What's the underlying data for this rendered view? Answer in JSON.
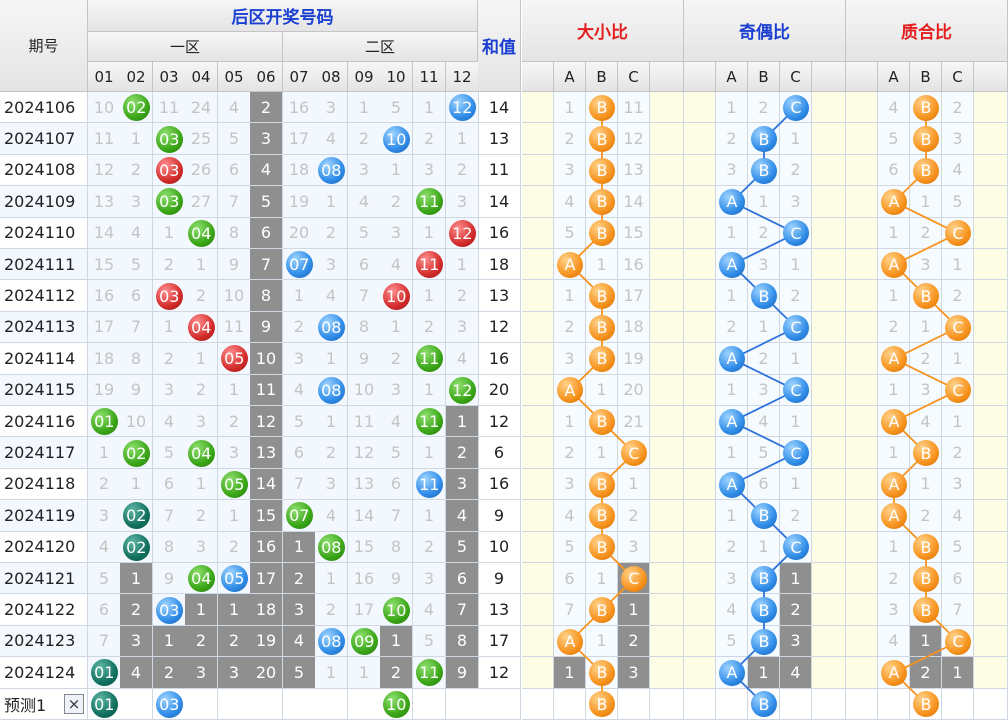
{
  "header": {
    "period": "期号",
    "back_zone": "后区开奖号码",
    "zone1": "一区",
    "zone2": "二区",
    "sum": "和值",
    "ratio_size": "大小比",
    "ratio_parity": "奇偶比",
    "ratio_prime": "质合比",
    "col_nums": [
      "01",
      "02",
      "03",
      "04",
      "05",
      "06",
      "07",
      "08",
      "09",
      "10",
      "11",
      "12"
    ],
    "abc": [
      "A",
      "B",
      "C"
    ]
  },
  "colors": {
    "green": "#3aa617",
    "red": "#d42c2c",
    "blue": "#2f8ce8",
    "teal": "#11705f",
    "orange": "#f7931e",
    "omit_gray": "#8f8f8f"
  },
  "rows": [
    {
      "period": "2024106",
      "cells": [
        "10",
        "02",
        "11",
        "24",
        "4",
        "2",
        "16",
        "3",
        "1",
        "5",
        "1",
        "12"
      ],
      "balls": {
        "1": "green",
        "11": "blue"
      },
      "gray": [
        5
      ],
      "sum": "14",
      "size": [
        "1",
        "B",
        "11"
      ],
      "size_pick": 1,
      "parity": [
        "1",
        "2",
        "C"
      ],
      "parity_pick": 2,
      "prime": [
        "4",
        "B",
        "2"
      ],
      "prime_pick": 1
    },
    {
      "period": "2024107",
      "cells": [
        "11",
        "1",
        "03",
        "25",
        "5",
        "3",
        "17",
        "4",
        "2",
        "10",
        "2",
        "1"
      ],
      "balls": {
        "2": "green",
        "9": "blue"
      },
      "gray": [
        5
      ],
      "sum": "13",
      "size": [
        "2",
        "B",
        "12"
      ],
      "size_pick": 1,
      "parity": [
        "2",
        "B",
        "1"
      ],
      "parity_pick": 1,
      "prime": [
        "5",
        "B",
        "3"
      ],
      "prime_pick": 1
    },
    {
      "period": "2024108",
      "cells": [
        "12",
        "2",
        "03",
        "26",
        "6",
        "4",
        "18",
        "08",
        "3",
        "1",
        "3",
        "2"
      ],
      "balls": {
        "2": "red",
        "7": "blue"
      },
      "gray": [
        5
      ],
      "sum": "11",
      "size": [
        "3",
        "B",
        "13"
      ],
      "size_pick": 1,
      "parity": [
        "3",
        "B",
        "2"
      ],
      "parity_pick": 1,
      "prime": [
        "6",
        "B",
        "4"
      ],
      "prime_pick": 1
    },
    {
      "period": "2024109",
      "cells": [
        "13",
        "3",
        "03",
        "27",
        "7",
        "5",
        "19",
        "1",
        "4",
        "2",
        "11",
        "3"
      ],
      "balls": {
        "2": "green",
        "10": "green"
      },
      "gray": [
        5
      ],
      "sum": "14",
      "size": [
        "4",
        "B",
        "14"
      ],
      "size_pick": 1,
      "parity": [
        "A",
        "1",
        "3"
      ],
      "parity_pick": 0,
      "prime": [
        "A",
        "1",
        "5"
      ],
      "prime_pick": 0
    },
    {
      "period": "2024110",
      "cells": [
        "14",
        "4",
        "1",
        "04",
        "8",
        "6",
        "20",
        "2",
        "5",
        "3",
        "1",
        "12"
      ],
      "balls": {
        "3": "green",
        "11": "red"
      },
      "gray": [
        5
      ],
      "sum": "16",
      "size": [
        "5",
        "B",
        "15"
      ],
      "size_pick": 1,
      "parity": [
        "1",
        "2",
        "C"
      ],
      "parity_pick": 2,
      "prime": [
        "1",
        "2",
        "C"
      ],
      "prime_pick": 2
    },
    {
      "period": "2024111",
      "cells": [
        "15",
        "5",
        "2",
        "1",
        "9",
        "7",
        "07",
        "3",
        "6",
        "4",
        "11",
        "1"
      ],
      "balls": {
        "6": "blue",
        "10": "red"
      },
      "gray": [
        5
      ],
      "sum": "18",
      "size": [
        "A",
        "1",
        "16"
      ],
      "size_pick": 0,
      "parity": [
        "A",
        "3",
        "1"
      ],
      "parity_pick": 0,
      "prime": [
        "A",
        "3",
        "1"
      ],
      "prime_pick": 0
    },
    {
      "period": "2024112",
      "cells": [
        "16",
        "6",
        "03",
        "2",
        "10",
        "8",
        "1",
        "4",
        "7",
        "10",
        "1",
        "2"
      ],
      "balls": {
        "2": "red",
        "9": "red"
      },
      "gray": [
        5
      ],
      "sum": "13",
      "size": [
        "1",
        "B",
        "17"
      ],
      "size_pick": 1,
      "parity": [
        "1",
        "B",
        "2"
      ],
      "parity_pick": 1,
      "prime": [
        "1",
        "B",
        "2"
      ],
      "prime_pick": 1
    },
    {
      "period": "2024113",
      "cells": [
        "17",
        "7",
        "1",
        "04",
        "11",
        "9",
        "2",
        "08",
        "8",
        "1",
        "2",
        "3"
      ],
      "balls": {
        "3": "red",
        "7": "blue"
      },
      "gray": [
        5
      ],
      "sum": "12",
      "size": [
        "2",
        "B",
        "18"
      ],
      "size_pick": 1,
      "parity": [
        "2",
        "1",
        "C"
      ],
      "parity_pick": 2,
      "prime": [
        "2",
        "1",
        "C"
      ],
      "prime_pick": 2
    },
    {
      "period": "2024114",
      "cells": [
        "18",
        "8",
        "2",
        "1",
        "05",
        "10",
        "3",
        "1",
        "9",
        "2",
        "11",
        "4"
      ],
      "balls": {
        "4": "red",
        "10": "green"
      },
      "gray": [
        5
      ],
      "sum": "16",
      "size": [
        "3",
        "B",
        "19"
      ],
      "size_pick": 1,
      "parity": [
        "A",
        "2",
        "1"
      ],
      "parity_pick": 0,
      "prime": [
        "A",
        "2",
        "1"
      ],
      "prime_pick": 0
    },
    {
      "period": "2024115",
      "cells": [
        "19",
        "9",
        "3",
        "2",
        "1",
        "11",
        "4",
        "08",
        "10",
        "3",
        "1",
        "12"
      ],
      "balls": {
        "7": "blue",
        "11": "green"
      },
      "gray": [
        5
      ],
      "sum": "20",
      "size": [
        "A",
        "1",
        "20"
      ],
      "size_pick": 0,
      "parity": [
        "1",
        "3",
        "C"
      ],
      "parity_pick": 2,
      "prime": [
        "1",
        "3",
        "C"
      ],
      "prime_pick": 2
    },
    {
      "period": "2024116",
      "cells": [
        "01",
        "10",
        "4",
        "3",
        "2",
        "12",
        "5",
        "1",
        "11",
        "4",
        "11",
        "1"
      ],
      "balls": {
        "0": "green",
        "10": "green"
      },
      "gray": [
        5,
        11
      ],
      "sum": "12",
      "size": [
        "1",
        "B",
        "21"
      ],
      "size_pick": 1,
      "parity": [
        "A",
        "4",
        "1"
      ],
      "parity_pick": 0,
      "prime": [
        "A",
        "4",
        "1"
      ],
      "prime_pick": 0
    },
    {
      "period": "2024117",
      "cells": [
        "1",
        "02",
        "5",
        "04",
        "3",
        "13",
        "6",
        "2",
        "12",
        "5",
        "1",
        "2"
      ],
      "balls": {
        "1": "green",
        "3": "green"
      },
      "gray": [
        5,
        11
      ],
      "sum": "6",
      "size": [
        "2",
        "1",
        "C"
      ],
      "size_pick": 2,
      "parity": [
        "1",
        "5",
        "C"
      ],
      "parity_pick": 2,
      "prime": [
        "1",
        "B",
        "2"
      ],
      "prime_pick": 1
    },
    {
      "period": "2024118",
      "cells": [
        "2",
        "1",
        "6",
        "1",
        "05",
        "14",
        "7",
        "3",
        "13",
        "6",
        "11",
        "3"
      ],
      "balls": {
        "4": "green",
        "10": "blue"
      },
      "gray": [
        5,
        11
      ],
      "sum": "16",
      "size": [
        "3",
        "B",
        "1"
      ],
      "size_pick": 1,
      "parity": [
        "A",
        "6",
        "1"
      ],
      "parity_pick": 0,
      "prime": [
        "A",
        "1",
        "3"
      ],
      "prime_pick": 0
    },
    {
      "period": "2024119",
      "cells": [
        "3",
        "02",
        "7",
        "2",
        "1",
        "15",
        "07",
        "4",
        "14",
        "7",
        "1",
        "4"
      ],
      "balls": {
        "1": "teal",
        "6": "green"
      },
      "gray": [
        5,
        11
      ],
      "sum": "9",
      "size": [
        "4",
        "B",
        "2"
      ],
      "size_pick": 1,
      "parity": [
        "1",
        "B",
        "2"
      ],
      "parity_pick": 1,
      "prime": [
        "A",
        "2",
        "4"
      ],
      "prime_pick": 0
    },
    {
      "period": "2024120",
      "cells": [
        "4",
        "02",
        "8",
        "3",
        "2",
        "16",
        "1",
        "08",
        "15",
        "8",
        "2",
        "5"
      ],
      "balls": {
        "1": "teal",
        "7": "green"
      },
      "gray": [
        5,
        6,
        11
      ],
      "sum": "10",
      "size": [
        "5",
        "B",
        "3"
      ],
      "size_pick": 1,
      "parity": [
        "2",
        "1",
        "C"
      ],
      "parity_pick": 2,
      "prime": [
        "1",
        "B",
        "5"
      ],
      "prime_pick": 1
    },
    {
      "period": "2024121",
      "cells": [
        "5",
        "1",
        "9",
        "04",
        "05",
        "17",
        "2",
        "1",
        "16",
        "9",
        "3",
        "6"
      ],
      "balls": {
        "3": "green",
        "4": "blue"
      },
      "gray": [
        1,
        5,
        6,
        11
      ],
      "sum": "9",
      "size": [
        "6",
        "1",
        "C"
      ],
      "size_pick": 2,
      "parity": [
        "3",
        "B",
        "1"
      ],
      "parity_pick": 1,
      "prime": [
        "2",
        "B",
        "6"
      ],
      "prime_pick": 1
    },
    {
      "period": "2024122",
      "cells": [
        "6",
        "2",
        "03",
        "1",
        "1",
        "18",
        "3",
        "2",
        "17",
        "10",
        "4",
        "7"
      ],
      "balls": {
        "2": "blue",
        "9": "green"
      },
      "gray": [
        1,
        3,
        4,
        5,
        6,
        11
      ],
      "sum": "13",
      "size": [
        "7",
        "B",
        "1"
      ],
      "size_pick": 1,
      "parity": [
        "4",
        "B",
        "2"
      ],
      "parity_pick": 1,
      "prime": [
        "3",
        "B",
        "7"
      ],
      "prime_pick": 1
    },
    {
      "period": "2024123",
      "cells": [
        "7",
        "3",
        "1",
        "2",
        "2",
        "19",
        "4",
        "08",
        "09",
        "1",
        "5",
        "8"
      ],
      "balls": {
        "7": "blue",
        "8": "green"
      },
      "gray": [
        1,
        2,
        3,
        4,
        5,
        6,
        9,
        11
      ],
      "sum": "17",
      "size": [
        "A",
        "1",
        "2"
      ],
      "size_pick": 0,
      "parity": [
        "5",
        "B",
        "3"
      ],
      "parity_pick": 1,
      "prime": [
        "4",
        "1",
        "C"
      ],
      "prime_pick": 2
    },
    {
      "period": "2024124",
      "cells": [
        "01",
        "4",
        "2",
        "3",
        "3",
        "20",
        "5",
        "1",
        "1",
        "2",
        "11",
        "9"
      ],
      "balls": {
        "0": "teal",
        "10": "green"
      },
      "gray": [
        1,
        2,
        3,
        4,
        5,
        6,
        9,
        11
      ],
      "sum": "12",
      "size": [
        "1",
        "B",
        "3"
      ],
      "size_pick": 1,
      "parity": [
        "A",
        "1",
        "4"
      ],
      "parity_pick": 0,
      "prime": [
        "A",
        "2",
        "1"
      ],
      "prime_pick": 0
    }
  ],
  "gray_extra": {
    "size": [
      [
        15,
        2
      ],
      [
        16,
        2
      ],
      [
        17,
        2
      ],
      [
        18,
        0
      ],
      [
        18,
        2
      ]
    ],
    "parity": [
      [
        15,
        2
      ],
      [
        16,
        2
      ],
      [
        17,
        2
      ],
      [
        18,
        1
      ],
      [
        18,
        2
      ]
    ],
    "prime": [
      [
        17,
        1
      ],
      [
        18,
        1
      ],
      [
        18,
        2
      ]
    ]
  },
  "predict": {
    "label": "预测1",
    "close": "×",
    "balls": {
      "0": "01",
      "2": "03",
      "9": "10"
    },
    "ball_colors": {
      "0": "teal",
      "2": "blue",
      "9": "green"
    },
    "size_pick": 1,
    "parity_pick": 1,
    "prime_pick": 1,
    "abc_text": "B"
  }
}
